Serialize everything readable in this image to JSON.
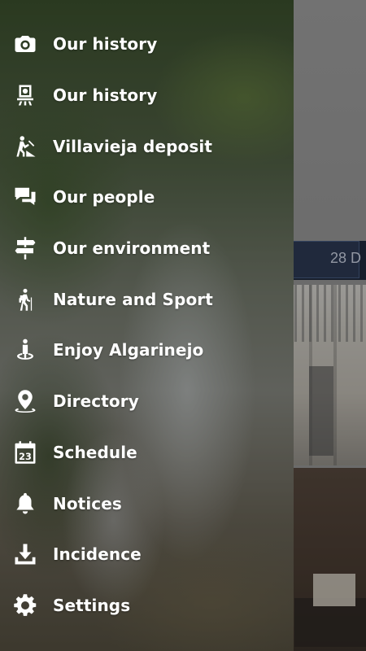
{
  "drawer": {
    "items": [
      {
        "label": "Our history",
        "icon": "camera-icon"
      },
      {
        "label": "Our history",
        "icon": "projector-icon"
      },
      {
        "label": "Villavieja deposit",
        "icon": "digging-worker-icon"
      },
      {
        "label": "Our people",
        "icon": "chat-bubbles-icon"
      },
      {
        "label": "Our environment",
        "icon": "signpost-icon"
      },
      {
        "label": "Nature and Sport",
        "icon": "hiker-icon"
      },
      {
        "label": "Enjoy Algarinejo",
        "icon": "person-info-icon"
      },
      {
        "label": "Directory",
        "icon": "map-pin-icon"
      },
      {
        "label": "Schedule",
        "icon": "calendar-icon",
        "badge": "23"
      },
      {
        "label": "Notices",
        "icon": "bell-icon"
      },
      {
        "label": "Incidence",
        "icon": "download-tray-icon"
      },
      {
        "label": "Settings",
        "icon": "gear-icon"
      }
    ]
  },
  "background": {
    "date_text": "28 D"
  },
  "colors": {
    "menu_text": "#ffffff",
    "date_bar": "#0f1a2e"
  }
}
